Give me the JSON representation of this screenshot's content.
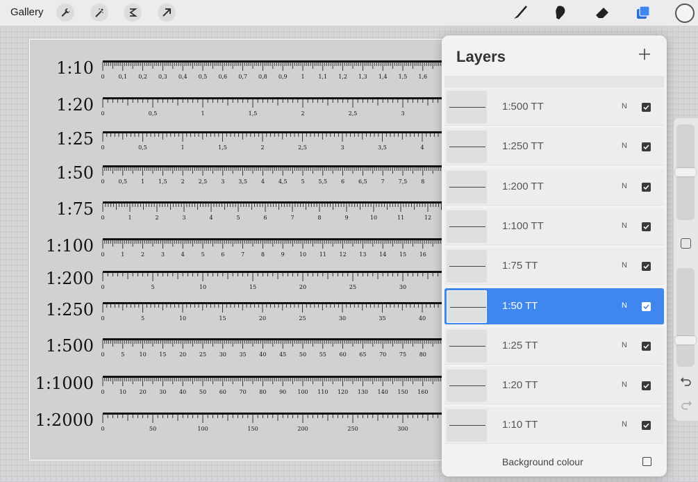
{
  "toolbar": {
    "gallery_label": "Gallery",
    "left_tools": [
      {
        "name": "actions-wrench-icon"
      },
      {
        "name": "adjustments-wand-icon"
      },
      {
        "name": "selection-icon"
      },
      {
        "name": "transform-arrow-icon"
      }
    ],
    "right_tools": [
      {
        "name": "brush-icon"
      },
      {
        "name": "smudge-icon"
      },
      {
        "name": "eraser-icon"
      },
      {
        "name": "layers-icon"
      }
    ],
    "accent_color": "#3f86ee",
    "current_color": "#f4f4f4"
  },
  "scales": [
    {
      "label": "1:10",
      "ticks": [
        "0",
        "0,1",
        "0,2",
        "0,3",
        "0,4",
        "0,5",
        "0,6",
        "0,7",
        "0,8",
        "0,9",
        "1",
        "1,1",
        "1,2",
        "1,3",
        "1,4",
        "1,5",
        "1,6"
      ]
    },
    {
      "label": "1:20",
      "ticks": [
        "0",
        "0,5",
        "1",
        "1,5",
        "2",
        "2,5",
        "3"
      ]
    },
    {
      "label": "1:25",
      "ticks": [
        "0",
        "0,5",
        "1",
        "1,5",
        "2",
        "2,5",
        "3",
        "3,5",
        "4"
      ]
    },
    {
      "label": "1:50",
      "ticks": [
        "0",
        "0,5",
        "1",
        "1,5",
        "2",
        "2,5",
        "3",
        "3,5",
        "4",
        "4,5",
        "5",
        "5,5",
        "6",
        "6,5",
        "7",
        "7,5",
        "8"
      ]
    },
    {
      "label": "1:75",
      "ticks": [
        "0",
        "1",
        "2",
        "3",
        "4",
        "5",
        "6",
        "7",
        "8",
        "9",
        "10",
        "11",
        "12"
      ]
    },
    {
      "label": "1:100",
      "ticks": [
        "0",
        "1",
        "2",
        "3",
        "4",
        "5",
        "6",
        "7",
        "8",
        "9",
        "10",
        "11",
        "12",
        "13",
        "14",
        "15",
        "16"
      ]
    },
    {
      "label": "1:200",
      "ticks": [
        "0",
        "5",
        "10",
        "15",
        "20",
        "25",
        "30"
      ]
    },
    {
      "label": "1:250",
      "ticks": [
        "0",
        "5",
        "10",
        "15",
        "20",
        "25",
        "30",
        "35",
        "40"
      ]
    },
    {
      "label": "1:500",
      "ticks": [
        "0",
        "5",
        "10",
        "15",
        "20",
        "25",
        "30",
        "35",
        "40",
        "45",
        "50",
        "55",
        "60",
        "65",
        "70",
        "75",
        "80"
      ]
    },
    {
      "label": "1:1000",
      "ticks": [
        "0",
        "10",
        "20",
        "30",
        "40",
        "50",
        "60",
        "70",
        "80",
        "90",
        "100",
        "110",
        "120",
        "130",
        "140",
        "150",
        "160"
      ]
    },
    {
      "label": "1:2000",
      "ticks": [
        "0",
        "50",
        "100",
        "150",
        "200",
        "250",
        "300"
      ]
    }
  ],
  "layers_panel": {
    "title": "Layers",
    "add_icon": "plus-icon",
    "layers": [
      {
        "name": "1:500 TT",
        "mode": "N",
        "visible": true,
        "active": false
      },
      {
        "name": "1:250 TT",
        "mode": "N",
        "visible": true,
        "active": false
      },
      {
        "name": "1:200 TT",
        "mode": "N",
        "visible": true,
        "active": false
      },
      {
        "name": "1:100 TT",
        "mode": "N",
        "visible": true,
        "active": false
      },
      {
        "name": "1:75 TT",
        "mode": "N",
        "visible": true,
        "active": false
      },
      {
        "name": "1:50 TT",
        "mode": "N",
        "visible": true,
        "active": true
      },
      {
        "name": "1:25 TT",
        "mode": "N",
        "visible": true,
        "active": false
      },
      {
        "name": "1:20 TT",
        "mode": "N",
        "visible": true,
        "active": false
      },
      {
        "name": "1:10 TT",
        "mode": "N",
        "visible": true,
        "active": false
      }
    ],
    "background_label": "Background colour",
    "background_visible": false
  },
  "sidebar": {
    "size_level": 0.5,
    "opacity_level": 0.25,
    "modify_icon": "square-modify-icon",
    "undo_icon": "undo-icon",
    "redo_icon": "redo-icon"
  }
}
